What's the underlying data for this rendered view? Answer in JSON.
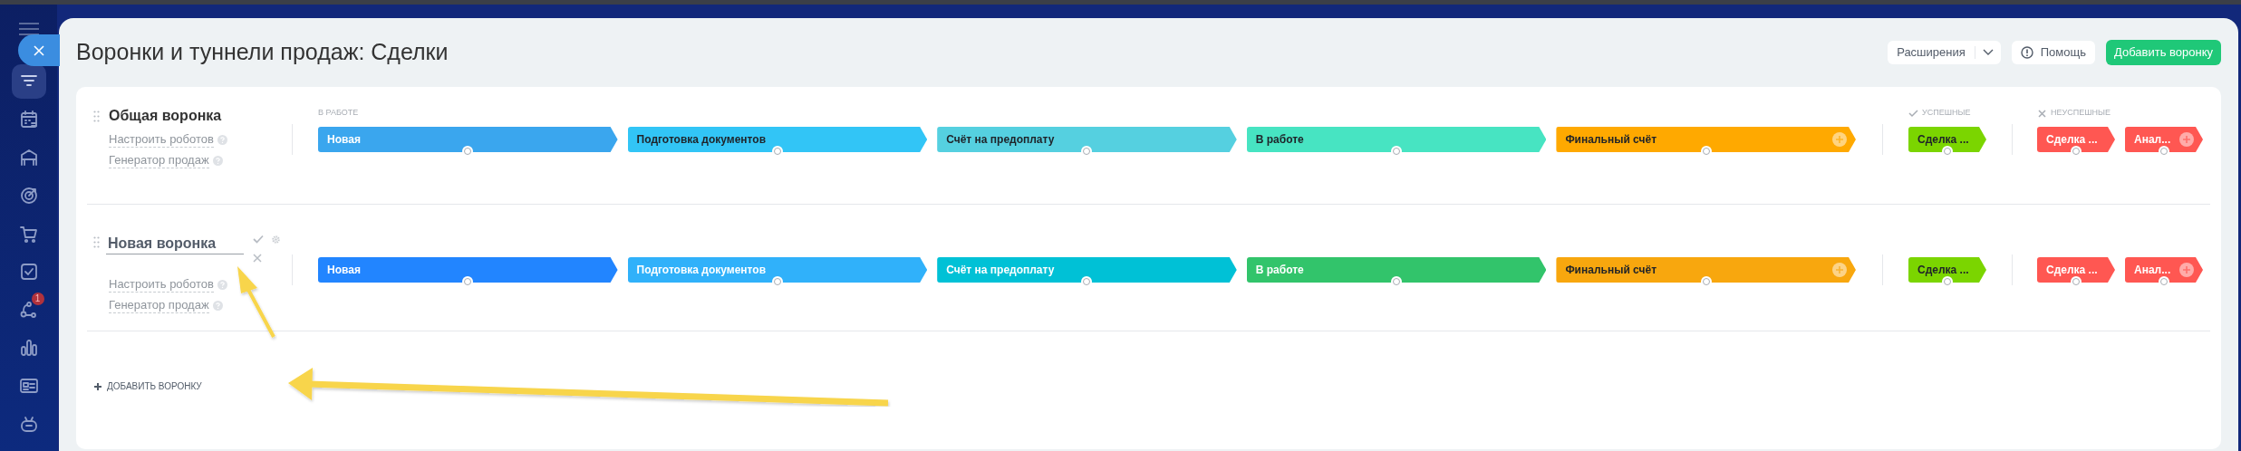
{
  "sidebar": {
    "items": [
      {
        "selected": true
      },
      {
        "selected": false
      },
      {
        "selected": false
      },
      {
        "selected": false
      },
      {
        "selected": false
      },
      {
        "selected": false
      },
      {
        "selected": false,
        "badge": "1"
      },
      {
        "selected": false
      },
      {
        "selected": false
      },
      {
        "selected": false
      }
    ]
  },
  "header": {
    "title": "Воронки и туннели продаж: Сделки",
    "buttons": [
      {
        "kind": "dropdown",
        "label": "Расширения"
      },
      {
        "kind": "help",
        "label": "Помощь"
      },
      {
        "kind": "primary",
        "label": "Добавить воронку"
      }
    ]
  },
  "funnels": [
    {
      "name": "Общая воронка",
      "editing": false,
      "links": [
        "Настроить роботов",
        "Генератор продаж"
      ],
      "groups": [
        {
          "kind": "in_work",
          "label": "В РАБОТЕ",
          "stages": [
            {
              "name": "Новая",
              "color": "#3aa6ee",
              "has_add": false
            },
            {
              "name": "Подготовка документов",
              "color": "#32c5f6",
              "has_add": false
            },
            {
              "name": "Счёт на предоплату",
              "color": "#55d0e0",
              "has_add": false
            },
            {
              "name": "В работе",
              "color": "#47e4c2",
              "has_add": false
            },
            {
              "name": "Финальный счёт",
              "color": "#ffa900",
              "has_add": true
            }
          ]
        },
        {
          "kind": "success",
          "label": "УСПЕШНЫЕ",
          "stages": [
            {
              "name": "Сделка ...",
              "color": "#7bd500",
              "has_add": false
            }
          ]
        },
        {
          "kind": "failure",
          "label": "НЕУСПЕШНЫЕ",
          "stages": [
            {
              "name": "Сделка ...",
              "color": "#ff5752",
              "has_add": false
            },
            {
              "name": "Анал...",
              "color": "#ff5752",
              "has_add": true
            }
          ]
        }
      ]
    },
    {
      "name": "Новая воронка",
      "editing": true,
      "links": [
        "Настроить роботов",
        "Генератор продаж"
      ],
      "groups": [
        {
          "kind": "in_work",
          "stages": [
            {
              "name": "Новая",
              "color": "#2285ff",
              "has_add": false
            },
            {
              "name": "Подготовка документов",
              "color": "#30b1fa",
              "has_add": false
            },
            {
              "name": "Счёт на предоплату",
              "color": "#00c1d6",
              "has_add": false
            },
            {
              "name": "В работе",
              "color": "#32c46b",
              "has_add": false
            },
            {
              "name": "Финальный счёт",
              "color": "#f8a70e",
              "has_add": true
            }
          ]
        },
        {
          "kind": "success",
          "stages": [
            {
              "name": "Сделка ...",
              "color": "#7bd500",
              "has_add": false
            }
          ]
        },
        {
          "kind": "failure",
          "stages": [
            {
              "name": "Сделка ...",
              "color": "#ff5752",
              "has_add": false
            },
            {
              "name": "Анал...",
              "color": "#ff5752",
              "has_add": true
            }
          ]
        }
      ]
    }
  ],
  "add_funnel_link": "ДОБАВИТЬ ВОРОНКУ"
}
